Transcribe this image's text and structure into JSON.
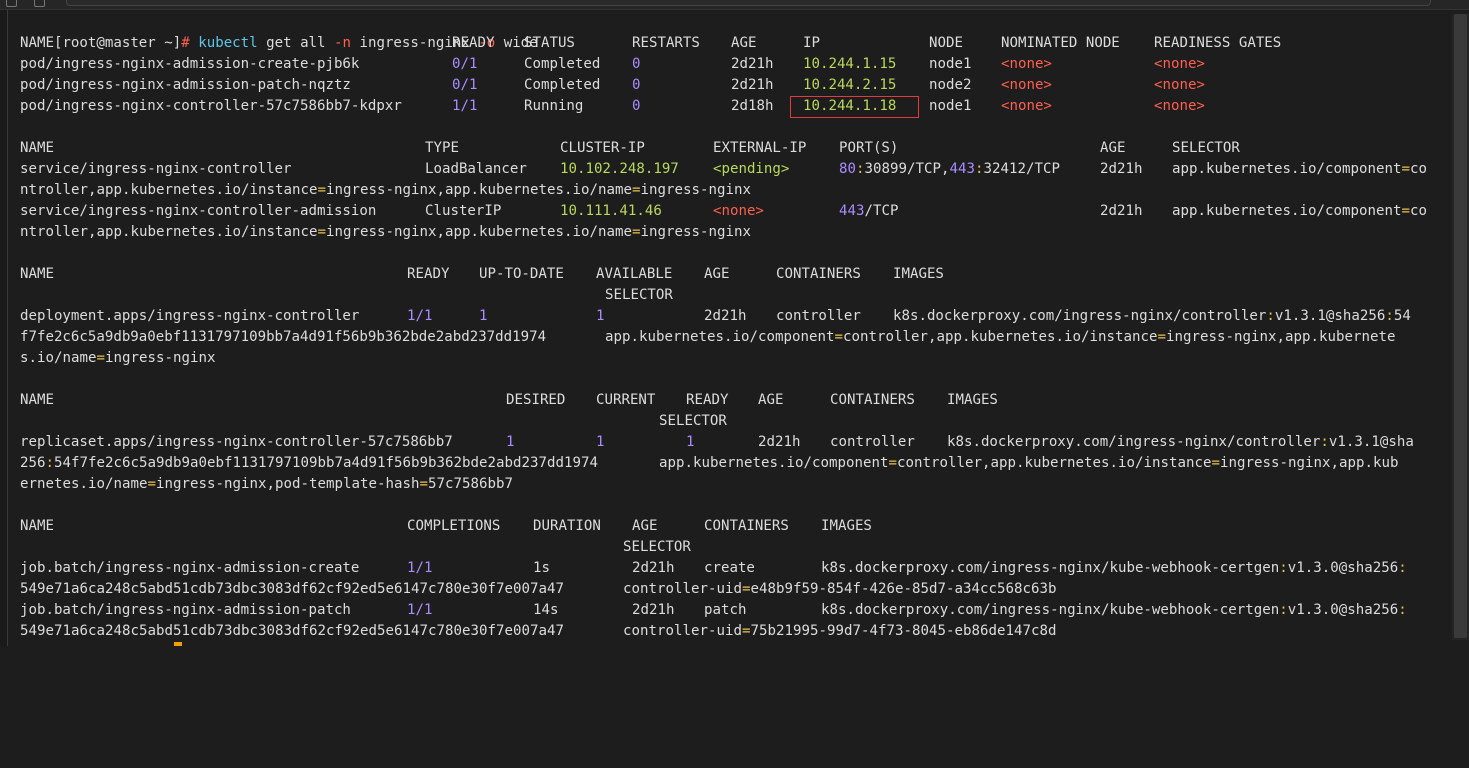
{
  "prompt": {
    "user_host": "[root@master ~]",
    "hash": "#",
    "cmd": "kubectl",
    "args": " get all ",
    "flag_n": "-n",
    "namespace": " ingress-nginx ",
    "flag_o": "-o",
    "output": " wide"
  },
  "pods": {
    "headers": [
      "NAME",
      "READY",
      "STATUS",
      "RESTARTS",
      "AGE",
      "IP",
      "NODE",
      "NOMINATED NODE",
      "READINESS GATES"
    ],
    "rows": [
      {
        "name": "pod/ingress-nginx-admission-create-pjb6k",
        "ready_a": "0",
        "ready_b": "/1",
        "status": "Completed",
        "restarts": "0",
        "age": "2d21h",
        "ip": "10.244.1.15",
        "node": "node1",
        "nominated": "<none>",
        "gates": "<none>"
      },
      {
        "name": "pod/ingress-nginx-admission-patch-nqztz",
        "ready_a": "0",
        "ready_b": "/1",
        "status": "Completed",
        "restarts": "0",
        "age": "2d21h",
        "ip": "10.244.2.15",
        "node": "node2",
        "nominated": "<none>",
        "gates": "<none>"
      },
      {
        "name": "pod/ingress-nginx-controller-57c7586bb7-kdpxr",
        "ready_a": "1",
        "ready_b": "/1",
        "status": "Running",
        "restarts": "0",
        "age": "2d18h",
        "ip": "10.244.1.18",
        "node": "node1",
        "nominated": "<none>",
        "gates": "<none>"
      }
    ]
  },
  "services": {
    "headers": [
      "NAME",
      "TYPE",
      "CLUSTER-IP",
      "EXTERNAL-IP",
      "PORT(S)",
      "AGE",
      "SELECTOR"
    ],
    "rows": [
      {
        "name": "service/ingress-nginx-controller",
        "type": "LoadBalancer",
        "cluster_ip": "10.102.248.197",
        "external_ip": "<pending>",
        "port_a": "80",
        "port_b": ":30899/TCP,",
        "port_c": "443",
        "port_d": ":32412/TCP",
        "age": "2d21h",
        "selector_a": "app.kubernetes.io/component=co",
        "selector_b": "ntroller,app.kubernetes.io/instance=ingress-nginx,app.kubernetes.io/name=ingress-nginx"
      },
      {
        "name": "service/ingress-nginx-controller-admission",
        "type": "ClusterIP",
        "cluster_ip": "10.111.41.46",
        "external_ip": "<none>",
        "port_a": "443",
        "port_b": "/TCP",
        "age": "2d21h",
        "selector_a": "app.kubernetes.io/component=co",
        "selector_b": "ntroller,app.kubernetes.io/instance=ingress-nginx,app.kubernetes.io/name=ingress-nginx"
      }
    ]
  },
  "deployments": {
    "headers": [
      "NAME",
      "READY",
      "UP-TO-DATE",
      "AVAILABLE",
      "AGE",
      "CONTAINERS",
      "IMAGES",
      "SELECTOR"
    ],
    "row": {
      "name": "deployment.apps/ingress-nginx-controller",
      "ready_a": "1",
      "ready_b": "/1",
      "uptodate": "1",
      "available": "1",
      "age": "2d21h",
      "containers": "controller",
      "image_a": "k8s.dockerproxy.com/ingress-nginx/controller",
      "image_b": ":v1.3.1@sha256:54",
      "line2_a": "f7fe2c6c5a9db9a0ebf1131797109bb7a4d91f56b9b362bde2abd237dd1974",
      "line2_b": "app.kubernetes.io/component=controller,app.kubernetes.io/instance=ingress-nginx,app.kubernete",
      "line3": "s.io/name=ingress-nginx"
    }
  },
  "replicasets": {
    "headers": [
      "NAME",
      "DESIRED",
      "CURRENT",
      "READY",
      "AGE",
      "CONTAINERS",
      "IMAGES",
      "SELECTOR"
    ],
    "row": {
      "name": "replicaset.apps/ingress-nginx-controller-57c7586bb7",
      "desired": "1",
      "current": "1",
      "ready": "1",
      "age": "2d21h",
      "containers": "controller",
      "image_a": "k8s.dockerproxy.com/ingress-nginx/controller",
      "image_b": ":v1.3.1@sha",
      "line2_a": "256:54f7fe2c6c5a9db9a0ebf1131797109bb7a4d91f56b9b362bde2abd237dd1974",
      "line2_b": "app.kubernetes.io/component=controller,app.kubernetes.io/instance=ingress-nginx,app.kub",
      "line3": "ernetes.io/name=ingress-nginx,pod-template-hash=57c7586bb7"
    }
  },
  "jobs": {
    "headers": [
      "NAME",
      "COMPLETIONS",
      "DURATION",
      "AGE",
      "CONTAINERS",
      "IMAGES",
      "SELECTOR"
    ],
    "rows": [
      {
        "name": "job.batch/ingress-nginx-admission-create",
        "completions_a": "1",
        "completions_b": "/1",
        "duration": "1s",
        "age": "2d21h",
        "containers": "create",
        "image_a": "k8s.dockerproxy.com/ingress-nginx/kube-webhook-certgen",
        "image_b": ":v1.3.0@sha256:",
        "line2_a": "549e71a6ca248c5abd51cdb73dbc3083df62cf92ed5e6147c780e30f7e007a47",
        "line2_b": "controller-uid=e48b9f59-854f-426e-85d7-a34cc568c63b"
      },
      {
        "name": "job.batch/ingress-nginx-admission-patch",
        "completions_a": "1",
        "completions_b": "/1",
        "duration": "14s",
        "age": "2d21h",
        "containers": "patch",
        "image_a": "k8s.dockerproxy.com/ingress-nginx/kube-webhook-certgen",
        "image_b": ":v1.3.0@sha256:",
        "line2_a": "549e71a6ca248c5abd51cdb73dbc3083df62cf92ed5e6147c780e30f7e007a47",
        "line2_b": "controller-uid=75b21995-99d7-4f73-8045-eb86de147c8d"
      }
    ]
  },
  "colors": {
    "background": "#1d1d1d",
    "green": "#b9d95a",
    "purple": "#a98cff",
    "red": "#ff5f4f",
    "highlight_box": "#e03c3c",
    "cursor": "#f0a000"
  }
}
